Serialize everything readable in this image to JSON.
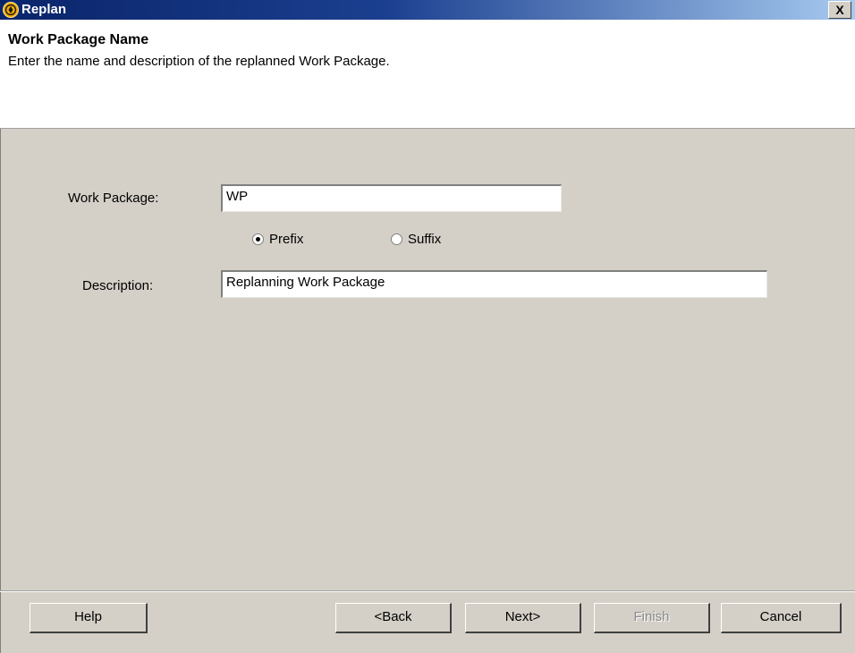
{
  "window": {
    "title": "Replan",
    "close_glyph": "X"
  },
  "header": {
    "title": "Work Package Name",
    "description": "Enter the name and description of the replanned Work Package."
  },
  "form": {
    "work_package_label": "Work Package:",
    "work_package_value": "WP",
    "radio_options": [
      {
        "label": "Prefix",
        "selected": true
      },
      {
        "label": "Suffix",
        "selected": false
      }
    ],
    "description_label": "Description:",
    "description_value": "Replanning Work Package"
  },
  "buttons": {
    "help": "Help",
    "back": "<Back",
    "next": "Next>",
    "finish": "Finish",
    "cancel": "Cancel"
  },
  "icons": {
    "app_icon": "replan-app-icon",
    "close_icon": "close-icon"
  },
  "colors": {
    "titlebar_start": "#0a246a",
    "titlebar_end": "#a6caf0",
    "dialog_background": "#d4d0c8",
    "app_icon": "#f2a900"
  }
}
